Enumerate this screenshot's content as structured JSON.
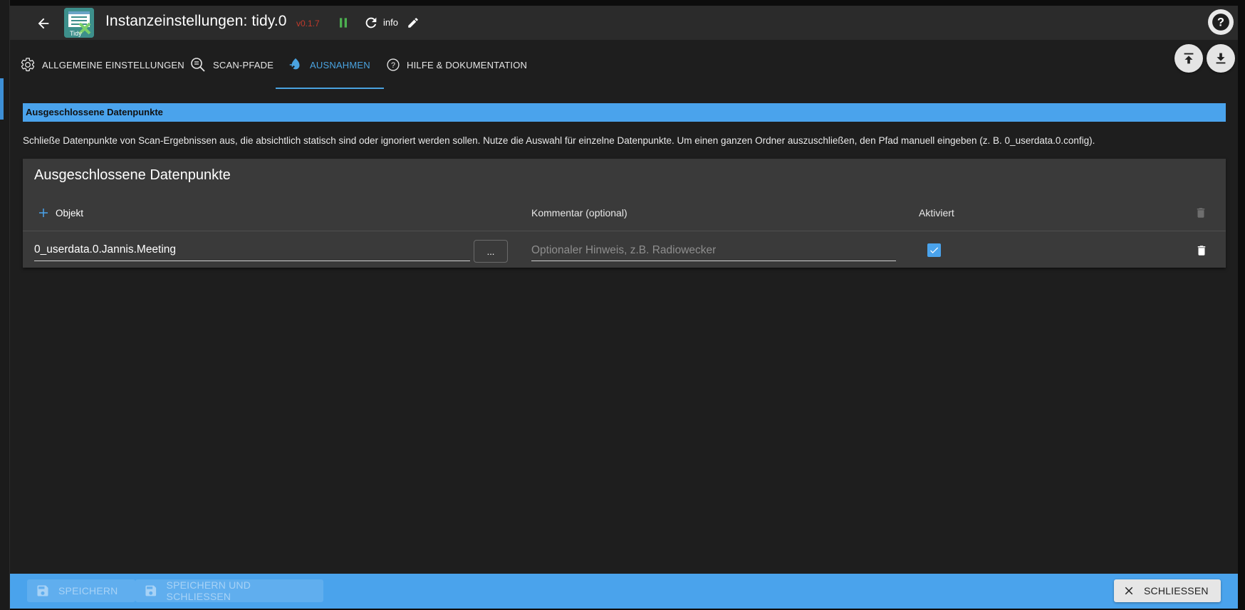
{
  "header": {
    "title": "Instanzeinstellungen: tidy.0",
    "logo_text": "Tidy",
    "version": "v0.1.7",
    "log_level": "info",
    "icons": {
      "back": "arrow-left-icon",
      "pause": "pause-icon",
      "reload": "reload-icon",
      "edit": "pencil-icon",
      "help": "help-circle-icon"
    }
  },
  "tabs": [
    {
      "label": "ALLGEMEINE EINSTELLUNGEN",
      "icon": "gear-icon",
      "active": false
    },
    {
      "label": "SCAN-PFADE",
      "icon": "search-list-icon",
      "active": false
    },
    {
      "label": "AUSNAHMEN",
      "icon": "exception-icon",
      "active": true
    },
    {
      "label": "HILFE & DOKUMENTATION",
      "icon": "help-circle-icon",
      "active": false
    }
  ],
  "tab_actions": {
    "upload_icon": "upload-icon",
    "download_icon": "download-icon"
  },
  "section": {
    "header": "Ausgeschlossene Datenpunkte",
    "description": "Schließe Datenpunkte von Scan-Ergebnissen aus, die absichtlich statisch sind oder ignoriert werden sollen. Nutze die Auswahl für einzelne Datenpunkte. Um einen ganzen Ordner auszuschließen, den Pfad manuell eingeben (z. B. 0_userdata.0.config)."
  },
  "table": {
    "title": "Ausgeschlossene Datenpunkte",
    "add_label": "Objekt",
    "columns": {
      "object": "Objekt",
      "comment": "Kommentar (optional)",
      "active": "Aktiviert"
    },
    "rows": [
      {
        "object": "0_userdata.0.Jannis.Meeting",
        "browse_label": "...",
        "comment": "",
        "comment_placeholder": "Optionaler Hinweis, z.B. Radiowecker",
        "active": true
      }
    ]
  },
  "footer": {
    "save_label": "SPEICHERN",
    "save_close_label": "SPEICHERN UND SCHLIESSEN",
    "close_label": "SCHLIESSEN"
  },
  "colors": {
    "accent": "#4aa3ec",
    "background": "#1e1e1e",
    "topbar": "#2b2b2b",
    "card": "#3a3a3a",
    "version": "#c0392b",
    "pause": "#4caf50"
  }
}
